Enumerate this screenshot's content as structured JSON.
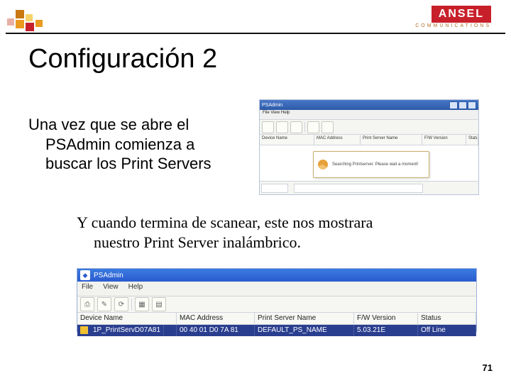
{
  "brand": {
    "name": "ANSEL",
    "sub": "COMMUNICATIONS"
  },
  "title": "Configuración 2",
  "para1_line1": "Una vez que se abre el",
  "para1_rest": "PSAdmin comienza a buscar los Print Servers",
  "para2_line1": "Y cuando termina de scanear, este nos mostrara",
  "para2_rest": "nuestro Print Server inalámbrico.",
  "page_number": "71",
  "shot1": {
    "title": "PSAdmin",
    "menu": "File   View   Help",
    "columns": {
      "c1": "Device Name",
      "c2": "MAC Address",
      "c3": "Print Server Name",
      "c4": "F/W Version",
      "c5": "Status"
    },
    "dialog_text": "Searching Printserver. Please wait a moment!"
  },
  "shot2": {
    "title": "PSAdmin",
    "menu": {
      "m1": "File",
      "m2": "View",
      "m3": "Help"
    },
    "columns": {
      "c1": "Device Name",
      "c2": "MAC Address",
      "c3": "Print Server Name",
      "c4": "F/W Version",
      "c5": "Status"
    },
    "row": {
      "device": "1P_PrintServD07A81",
      "mac": "00 40 01 D0 7A 81",
      "psname": "DEFAULT_PS_NAME",
      "fw": "5.03.21E",
      "status": "Off Line"
    }
  }
}
